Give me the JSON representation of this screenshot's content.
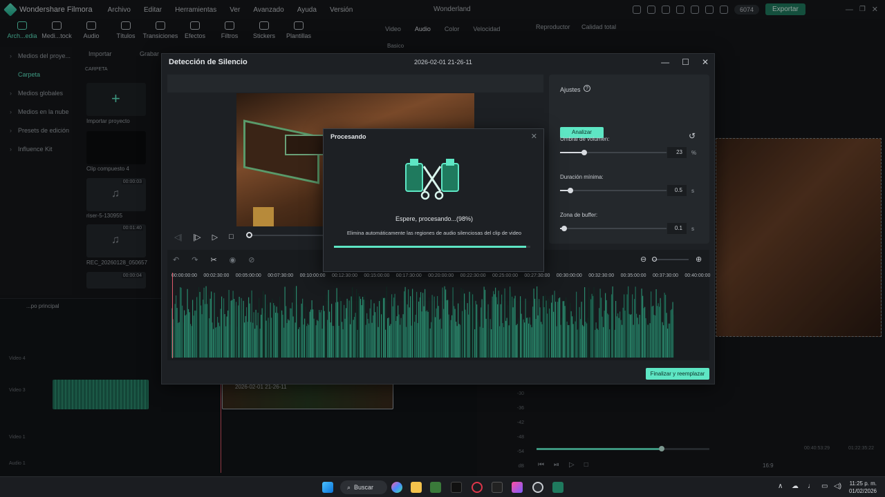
{
  "app": {
    "name": "Wondershare Filmora",
    "menu": [
      "Archivo",
      "Editar",
      "Herramientas",
      "Ver",
      "Avanzado",
      "Ayuda",
      "Versión"
    ],
    "project_title": "Wonderland",
    "credits": "6074",
    "export_label": "Exportar"
  },
  "toolbar": [
    "Arch...edia",
    "Medi...tock",
    "Audio",
    "Títulos",
    "Transiciones",
    "Efectos",
    "Filtros",
    "Stickers",
    "Plantillas"
  ],
  "left_nav": [
    "Medios del proye...",
    "Carpeta",
    "Medios globales",
    "Medios en la nube",
    "Presets de edición",
    "Influence Kit"
  ],
  "media": {
    "import_label": "Importar",
    "record_label": "Grabar",
    "folder_label": "CARPETA",
    "items": [
      {
        "caption": "Importar proyecto",
        "duration": ""
      },
      {
        "caption": "Clip compuesto 4",
        "duration": ""
      },
      {
        "caption": "riser-5-130955",
        "duration": "00:00:03"
      },
      {
        "caption": "REC_20260128_050657",
        "duration": "00:01:40"
      },
      {
        "caption": "",
        "duration": "00:00:04"
      }
    ]
  },
  "props_tabs": [
    "Video",
    "Audio",
    "Color",
    "Velocidad"
  ],
  "props_subtab": "Basico",
  "player": {
    "label": "Reproductor",
    "quality": "Calidad total",
    "current": "00:40:53:29",
    "total": "01:22:35:22",
    "ratio": "16:9"
  },
  "timeline": {
    "track_name": "...po principal",
    "clip_label": "2026-02-01 21-26-11",
    "tracks": [
      "Video 4",
      "Video 3",
      "Video 1",
      "Audio 1"
    ],
    "meter": [
      "-30",
      "-36",
      "-42",
      "-48",
      "-54",
      "dB"
    ]
  },
  "dialog": {
    "title": "Detección de Silencio",
    "timestamp": "2026-02-01 21-26-11",
    "settings": {
      "heading": "Ajustes",
      "analyze_label": "Analizar",
      "volume_label": "Umbral de volumen:",
      "volume_value": "23",
      "volume_unit": "%",
      "volume_fraction": 0.23,
      "min_duration_label": "Duración mínima:",
      "min_duration_value": "0.5",
      "min_duration_unit": "s",
      "min_duration_fraction": 0.1,
      "buffer_label": "Zona de buffer:",
      "buffer_value": "0.1",
      "buffer_unit": "s",
      "buffer_fraction": 0.04
    },
    "ruler": [
      "00:00:00:00",
      "00:02:30:00",
      "00:05:00:00",
      "00:07:30:00",
      "00:10:00:00",
      "00:12:30:00",
      "00:15:00:00",
      "00:17:30:00",
      "00:20:00:00",
      "00:22:30:00",
      "00:25:00:00",
      "00:27:30:00",
      "00:30:00:00",
      "00:32:30:00",
      "00:35:00:00",
      "00:37:30:00",
      "00:40:00:00"
    ],
    "finish_label": "Finalizar y reemplazar"
  },
  "processing": {
    "title": "Procesando",
    "message": "Espere, procesando...(98%)",
    "description": "Elimina automáticamente las regiones de audio silenciosas del clip de video",
    "progress": 0.98
  },
  "taskbar": {
    "search_label": "Buscar",
    "time": "11:25 p. m.",
    "date": "01/02/2026"
  },
  "colors": {
    "accent": "#5ee6c4",
    "dialog_bg": "#1d2024",
    "playhead": "#e05a6b"
  }
}
